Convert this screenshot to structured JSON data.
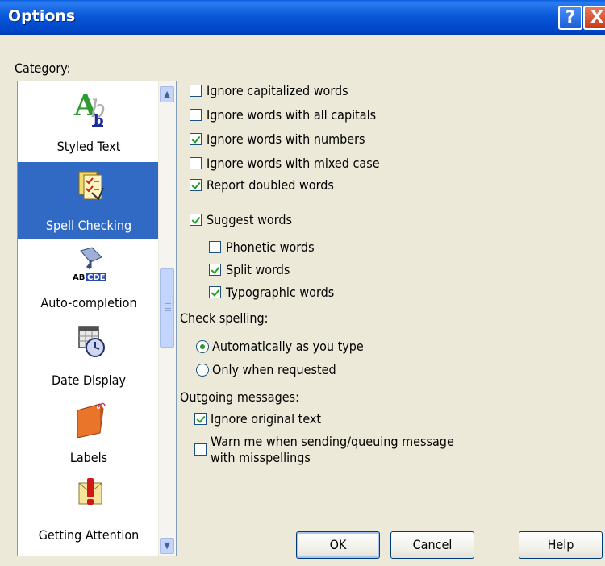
{
  "window": {
    "title": "Options",
    "help_glyph": "?",
    "close_glyph": "X"
  },
  "category": {
    "label": "Category:",
    "items": [
      {
        "label": "Styled Text",
        "icon": "styled-text-icon",
        "selected": false
      },
      {
        "label": "Spell Checking",
        "icon": "spell-checking-icon",
        "selected": true
      },
      {
        "label": "Auto-completion",
        "icon": "auto-completion-icon",
        "selected": false
      },
      {
        "label": "Date Display",
        "icon": "date-display-icon",
        "selected": false
      },
      {
        "label": "Labels",
        "icon": "labels-icon",
        "selected": false
      },
      {
        "label": "Getting Attention",
        "icon": "getting-attention-icon",
        "selected": false
      }
    ]
  },
  "options": {
    "ignore_capitalized": {
      "label": "Ignore capitalized words",
      "checked": false
    },
    "ignore_all_caps": {
      "label": "Ignore words with all capitals",
      "checked": false
    },
    "ignore_numbers": {
      "label": "Ignore words with numbers",
      "checked": true
    },
    "ignore_mixed_case": {
      "label": "Ignore words with mixed case",
      "checked": false
    },
    "report_doubled": {
      "label": "Report doubled words",
      "checked": true
    },
    "suggest_words": {
      "label": "Suggest words",
      "checked": true
    },
    "phonetic_words": {
      "label": "Phonetic words",
      "checked": false
    },
    "split_words": {
      "label": "Split words",
      "checked": true
    },
    "typographic_words": {
      "label": "Typographic words",
      "checked": true
    }
  },
  "check_spelling": {
    "heading": "Check spelling:",
    "automatic": {
      "label": "Automatically as you type",
      "selected": true
    },
    "on_request": {
      "label": "Only when requested",
      "selected": false
    }
  },
  "outgoing": {
    "heading": "Outgoing messages:",
    "ignore_original": {
      "label": "Ignore original text",
      "checked": true
    },
    "warn_line1": "Warn me when sending/queuing message",
    "warn_line2": "with misspellings",
    "warn_checked": false
  },
  "buttons": {
    "ok": "OK",
    "cancel": "Cancel",
    "help": "Help"
  },
  "colors": {
    "titlebar": "#0a58d8",
    "selection": "#316ac5",
    "dialog_bg": "#ece9d8",
    "check": "#21a121"
  }
}
